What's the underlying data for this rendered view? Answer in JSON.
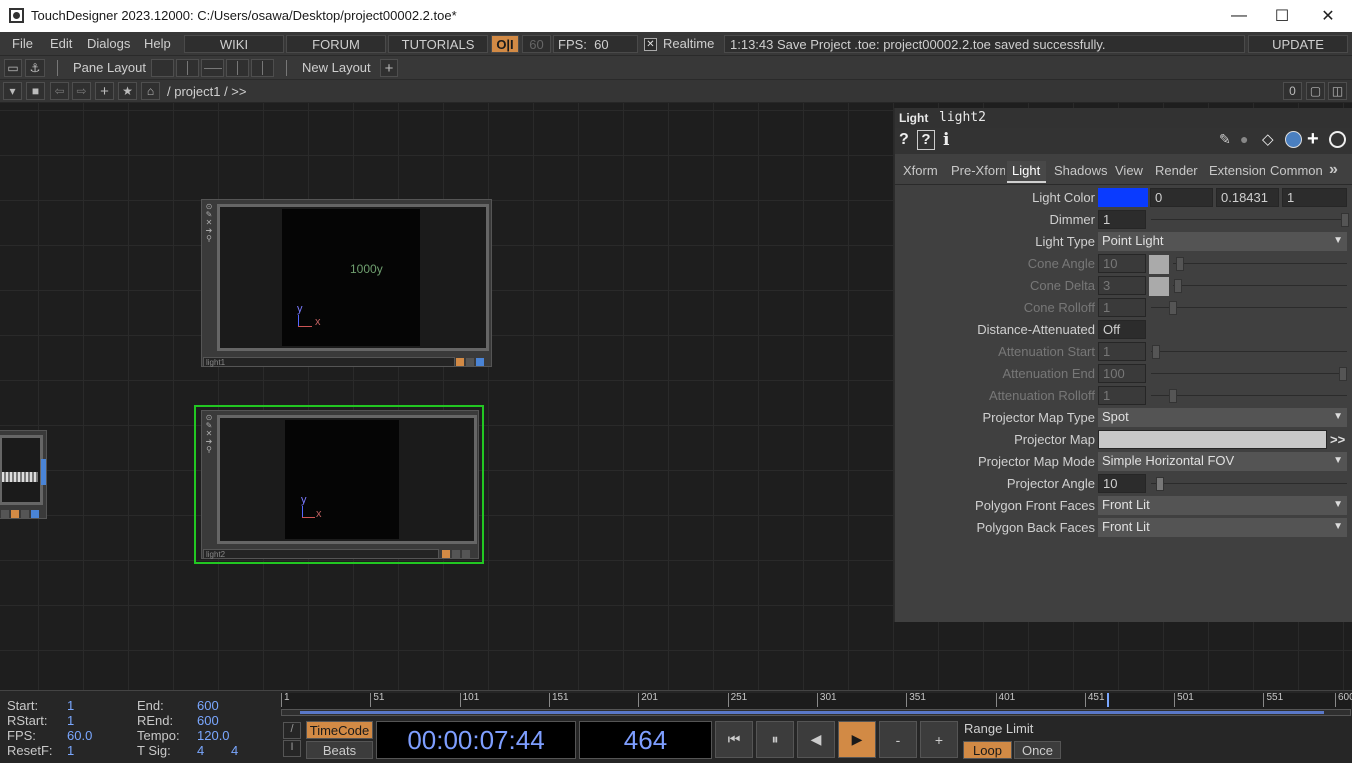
{
  "window": {
    "title": "TouchDesigner 2023.12000: C:/Users/osawa/Desktop/project00002.2.toe*",
    "minimize": "—",
    "maximize": "☐",
    "close": "✕"
  },
  "menu": {
    "items": [
      "File",
      "Edit",
      "Dialogs",
      "Help"
    ],
    "wiki": "WIKI",
    "forum": "FORUM",
    "tutorials": "TUTORIALS",
    "oi": "O|I",
    "fps_cap": "60",
    "fps_label": "FPS:",
    "fps_value": "60",
    "realtime_check": "✕",
    "realtime_label": "Realtime",
    "status": "1:13:43 Save Project .toe: project00002.2.toe saved successfully.",
    "update": "UPDATE"
  },
  "toolbar2": {
    "pane_layout": "Pane Layout",
    "new_layout": "New Layout",
    "plus": "+"
  },
  "pathbar": {
    "path": "/ project1 / >>",
    "count": "0"
  },
  "nodes": {
    "light1": {
      "label": "light1",
      "viewer_text": "1000y",
      "axis_y": "y",
      "axis_x": "x"
    },
    "light2": {
      "label": "light2",
      "axis_y": "y",
      "axis_x": "x"
    }
  },
  "panel": {
    "op_type": "Light",
    "op_name": "light2",
    "tabs": [
      "Xform",
      "Pre-Xform",
      "Light",
      "Shadows",
      "View",
      "Render",
      "Extensions",
      "Common"
    ],
    "active_tab": "Light",
    "more": "»",
    "params": {
      "light_color": {
        "label": "Light Color",
        "r": "0",
        "g": "0.18431",
        "b": "1",
        "swatch": "#0a3bff"
      },
      "dimmer": {
        "label": "Dimmer",
        "value": "1"
      },
      "light_type": {
        "label": "Light Type",
        "value": "Point Light"
      },
      "cone_angle": {
        "label": "Cone Angle",
        "value": "10"
      },
      "cone_delta": {
        "label": "Cone Delta",
        "value": "3"
      },
      "cone_rolloff": {
        "label": "Cone Rolloff",
        "value": "1"
      },
      "distance_attenuated": {
        "label": "Distance-Attenuated",
        "value": "Off"
      },
      "attenuation_start": {
        "label": "Attenuation Start",
        "value": "1"
      },
      "attenuation_end": {
        "label": "Attenuation End",
        "value": "100"
      },
      "attenuation_rolloff": {
        "label": "Attenuation Rolloff",
        "value": "1"
      },
      "projector_map_type": {
        "label": "Projector Map Type",
        "value": "Spot"
      },
      "projector_map": {
        "label": "Projector Map",
        "value": "",
        "more": ">>"
      },
      "projector_map_mode": {
        "label": "Projector Map Mode",
        "value": "Simple Horizontal FOV"
      },
      "projector_angle": {
        "label": "Projector Angle",
        "value": "10"
      },
      "polygon_front_faces": {
        "label": "Polygon Front Faces",
        "value": "Front Lit"
      },
      "polygon_back_faces": {
        "label": "Polygon Back Faces",
        "value": "Front Lit"
      }
    }
  },
  "timeline": {
    "start_label": "Start:",
    "start": "1",
    "end_label": "End:",
    "end": "600",
    "rstart_label": "RStart:",
    "rstart": "1",
    "rend_label": "REnd:",
    "rend": "600",
    "fps_label": "FPS:",
    "fps": "60.0",
    "tempo_label": "Tempo:",
    "tempo": "120.0",
    "resetf_label": "ResetF:",
    "resetf": "1",
    "tsig_label": "T Sig:",
    "tsig_a": "4",
    "tsig_b": "4",
    "ruler": [
      "1",
      "51",
      "101",
      "151",
      "201",
      "251",
      "301",
      "351",
      "401",
      "451",
      "501",
      "551",
      "600"
    ],
    "timecode_btn": "TimeCode",
    "beats_btn": "Beats",
    "timecode": "00:00:07:44",
    "frame": "464",
    "range_limit": "Range Limit",
    "loop": "Loop",
    "once": "Once",
    "btn_rewind": "⏮",
    "btn_pause": "⏸",
    "btn_back": "◀",
    "btn_play": "▶",
    "btn_minus": "-",
    "btn_plus": "+"
  }
}
